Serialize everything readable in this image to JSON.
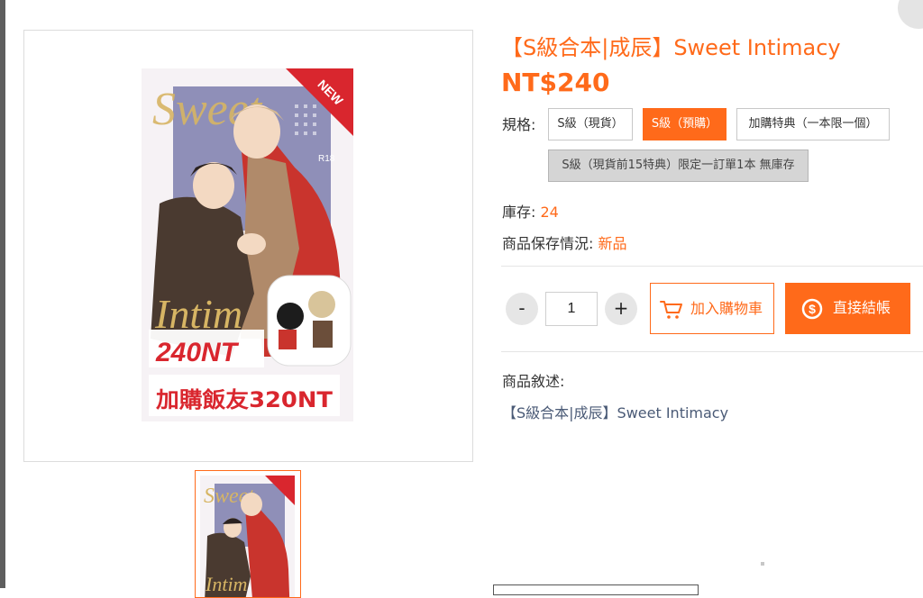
{
  "product": {
    "title": "【S級合本|成辰】Sweet Intimacy",
    "price": "NT$240"
  },
  "spec": {
    "label": "規格:",
    "options": [
      {
        "label": "S級（現貨）",
        "state": "normal"
      },
      {
        "label": "S級（預購）",
        "state": "selected"
      },
      {
        "label": "加購特典（一本限一個）",
        "state": "normal"
      },
      {
        "label": "S級（現貨前15特典）限定一訂單1本 無庫存",
        "state": "disabled"
      }
    ]
  },
  "stock": {
    "label": "庫存: ",
    "value": "24"
  },
  "condition": {
    "label": "商品保存情況: ",
    "value": "新品"
  },
  "quantity": {
    "minus": "-",
    "value": "1",
    "plus": "+"
  },
  "actions": {
    "add_to_cart": "加入購物車",
    "buy_now": "直接結帳"
  },
  "description": {
    "label": "商品敘述:",
    "text": "【S級合本|成辰】Sweet Intimacy"
  },
  "cover": {
    "title_word1": "Sweet",
    "title_word2": "Intim",
    "badge": "NEW",
    "rating": "R18",
    "price_line": "240NT",
    "addon_line": "加購飯友320NT"
  },
  "colors": {
    "accent": "#ff6a1a",
    "selected_option_bg": "#ff6a1a",
    "disabled_option_bg": "#d5d5d5",
    "description_text": "#4a5a76",
    "cover_red": "#d9262e",
    "cover_purple": "#8f8fb8",
    "cover_gold": "#d7b564"
  }
}
